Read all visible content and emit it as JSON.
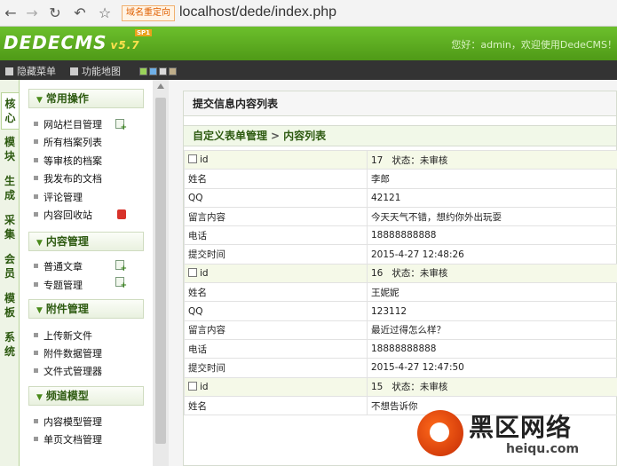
{
  "browser": {
    "redirect_badge": "域名重定向",
    "url": "localhost/dede/index.php"
  },
  "app": {
    "logo": "DEDECMS",
    "logo_badge": "SP1",
    "version": "v5.7",
    "welcome": "您好：admin，欢迎使用DedeCMS！"
  },
  "toolbar": {
    "hide_menu": "隐藏菜单",
    "function_map": "功能地图",
    "swatch_colors": [
      "#9bd35a",
      "#6fb0e8",
      "#d9d9d9",
      "#bfae8a"
    ]
  },
  "vtabs": [
    "核心",
    "模块",
    "生成",
    "采集",
    "会员",
    "模板",
    "系统"
  ],
  "sidebar": {
    "groups": [
      {
        "title": "常用操作",
        "items": [
          "网站栏目管理",
          "所有档案列表",
          "等审核的档案",
          "我发布的文档",
          "评论管理",
          "内容回收站"
        ]
      },
      {
        "title": "内容管理",
        "items": [
          "普通文章",
          "专题管理"
        ]
      },
      {
        "title": "附件管理",
        "items": [
          "上传新文件",
          "附件数据管理",
          "文件式管理器"
        ]
      },
      {
        "title": "频道模型",
        "items": [
          "内容模型管理",
          "单页文档管理"
        ]
      }
    ]
  },
  "panel": {
    "title": "提交信息内容列表",
    "breadcrumb": [
      "自定义表单管理",
      "内容列表"
    ]
  },
  "labels": {
    "id": "id",
    "name": "姓名",
    "qq": "QQ",
    "message": "留言内容",
    "phone": "电话",
    "time": "提交时间",
    "status_prefix": "状态："
  },
  "records": [
    {
      "id": "17",
      "status": "未审核",
      "name": "李郎",
      "qq": "42121",
      "message": "今天天气不错，想约你外出玩耍",
      "phone": "18888888888",
      "time": "2015-4-27 12:48:26"
    },
    {
      "id": "16",
      "status": "未审核",
      "name": "王妮妮",
      "qq": "123112",
      "message": "最近过得怎么样？",
      "phone": "18888888888",
      "time": "2015-4-27 12:47:50"
    },
    {
      "id": "15",
      "status": "未审核",
      "name": "不想告诉你"
    }
  ],
  "watermark": {
    "title": "黑区网络",
    "subtitle": "heiqu.com"
  }
}
